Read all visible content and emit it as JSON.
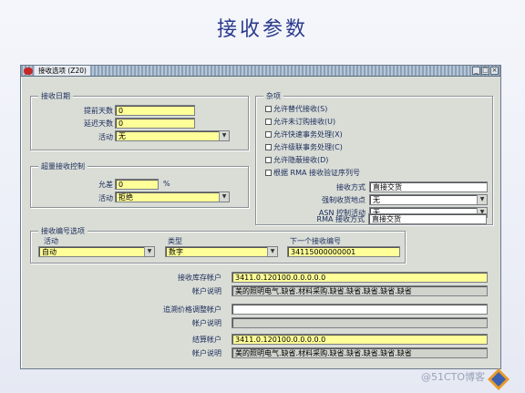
{
  "slide": {
    "title": "接收参数",
    "watermark": "@51CTO博客"
  },
  "window": {
    "title": "接收选项 (Z20)"
  },
  "receipt_date": {
    "group_title": "接收日期",
    "days_early_label": "提前天数",
    "days_early_value": "0",
    "days_late_label": "延迟天数",
    "days_late_value": "0",
    "action_label": "活动",
    "action_value": "无"
  },
  "over_receipt": {
    "group_title": "超量接收控制",
    "tolerance_label": "允差",
    "tolerance_value": "0",
    "tolerance_unit": "%",
    "action_label": "活动",
    "action_value": "拒绝"
  },
  "misc": {
    "group_title": "杂项",
    "checkboxes": [
      "允许替代接收(S)",
      "允许未订购接收(U)",
      "允许快速事务处理(X)",
      "允许级联事务处理(C)",
      "允许隐蔽接收(D)",
      "根据 RMA 接收验证序列号"
    ],
    "routing_label": "接收方式",
    "routing_value": "直接交货",
    "enforce_ship_to_label": "强制收货地点",
    "enforce_ship_to_value": "无",
    "asn_control_label": "ASN 控制活动",
    "asn_control_value": "无",
    "rma_routing_label": "RMA 接收方式",
    "rma_routing_value": "直接交货"
  },
  "receipt_number": {
    "group_title": "接收编号选项",
    "entry_label": "活动",
    "entry_value": "自动",
    "type_label": "类型",
    "type_value": "数字",
    "next_label": "下一个接收编号",
    "next_value": "34115000000001"
  },
  "accounts": {
    "inventory_ap_label": "接收库存帐户",
    "inventory_ap_value": "3411.0.120100.0.0.0.0.0",
    "inventory_ap_desc_label": "帐户说明",
    "inventory_ap_desc_value": "美的照明电气.缺省.材料采购.缺省.缺省.缺省.缺省.缺省",
    "retro_label": "追溯价格调整帐户",
    "retro_value": "",
    "retro_desc_label": "帐户说明",
    "retro_desc_value": "",
    "clearing_label": "结算帐户",
    "clearing_value": "3411.0.120100.0.0.0.0.0",
    "clearing_desc_label": "帐户说明",
    "clearing_desc_value": "美的照明电气.缺省.材料采购.缺省.缺省.缺省.缺省.缺省"
  },
  "colors": {
    "required_field": "#ffff99",
    "frame": "#d9ddd6",
    "title": "#2b3a8c"
  }
}
